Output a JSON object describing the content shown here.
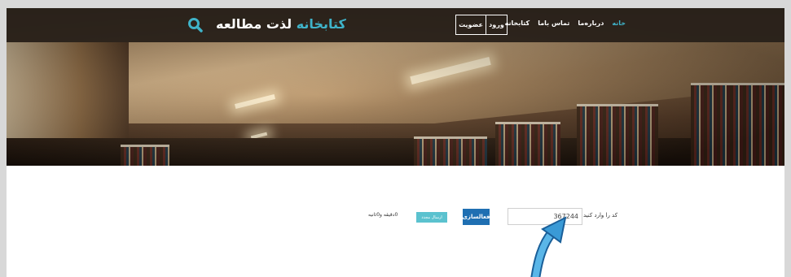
{
  "nav": {
    "items": [
      {
        "label": "خانه",
        "active": true
      },
      {
        "label": "درباره‌ما",
        "active": false
      },
      {
        "label": "تماس باما",
        "active": false
      },
      {
        "label": "کتابخانه",
        "active": false
      }
    ],
    "login_label": "ورود",
    "signup_label": "عضویت"
  },
  "brand": {
    "part_colored": "کتابخانه",
    "part_white": " لذت مطالعه"
  },
  "search_icon": "search-icon",
  "form": {
    "captcha_label": "کد را وارد کنید",
    "captcha_value": "367244",
    "activate_label": "فعالسازی",
    "resend_label": "ارسال مجدد",
    "timer_text": "0دقیقه و0ثانیه"
  },
  "colors": {
    "accent": "#3fb3c9",
    "primary_button": "#1f6fb2",
    "resend_button": "#5bc2cf",
    "navbar": "#28211a",
    "arrow": "#3a9ad6"
  }
}
